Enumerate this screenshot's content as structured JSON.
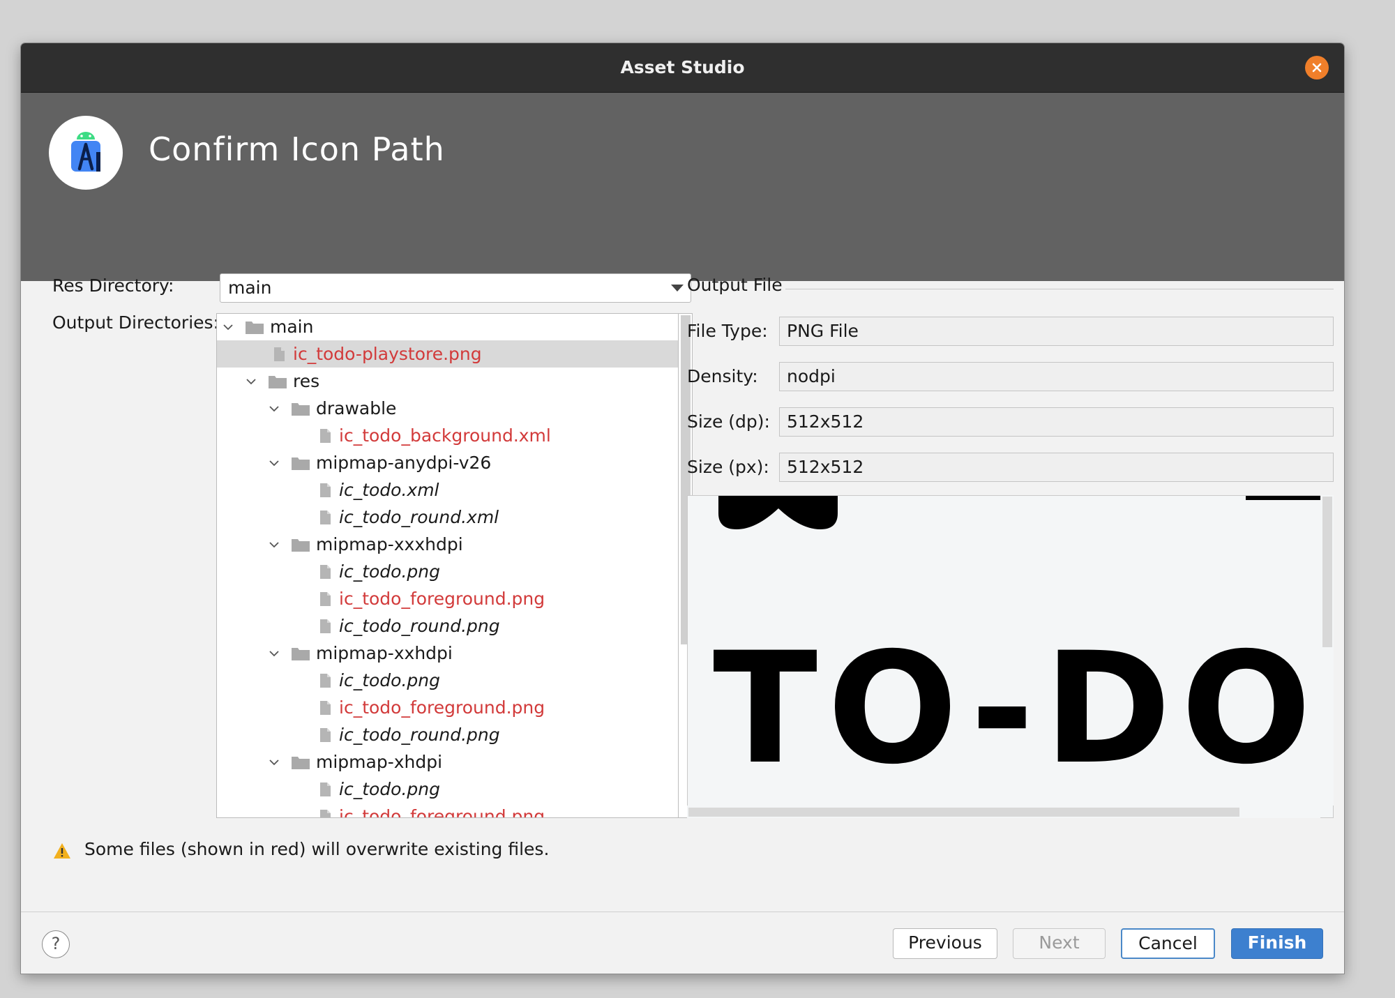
{
  "window": {
    "title": "Asset Studio",
    "header_title": "Confirm Icon Path"
  },
  "left": {
    "res_directory_label": "Res Directory:",
    "res_directory_value": "main",
    "output_directories_label": "Output Directories:"
  },
  "tree": [
    {
      "label": "main",
      "type": "folder",
      "depth": 0,
      "expanded": true,
      "red": false,
      "italic": false
    },
    {
      "label": "ic_todo-playstore.png",
      "type": "file",
      "depth": 1,
      "red": true,
      "italic": false,
      "selected": true
    },
    {
      "label": "res",
      "type": "folder",
      "depth": 1,
      "expanded": true,
      "red": false,
      "italic": false
    },
    {
      "label": "drawable",
      "type": "folder",
      "depth": 2,
      "expanded": true,
      "red": false,
      "italic": false
    },
    {
      "label": "ic_todo_background.xml",
      "type": "file",
      "depth": 3,
      "red": true,
      "italic": false
    },
    {
      "label": "mipmap-anydpi-v26",
      "type": "folder",
      "depth": 2,
      "expanded": true,
      "red": false,
      "italic": false
    },
    {
      "label": "ic_todo.xml",
      "type": "file",
      "depth": 3,
      "red": false,
      "italic": true
    },
    {
      "label": "ic_todo_round.xml",
      "type": "file",
      "depth": 3,
      "red": false,
      "italic": true
    },
    {
      "label": "mipmap-xxxhdpi",
      "type": "folder",
      "depth": 2,
      "expanded": true,
      "red": false,
      "italic": false
    },
    {
      "label": "ic_todo.png",
      "type": "file",
      "depth": 3,
      "red": false,
      "italic": true
    },
    {
      "label": "ic_todo_foreground.png",
      "type": "file",
      "depth": 3,
      "red": true,
      "italic": false
    },
    {
      "label": "ic_todo_round.png",
      "type": "file",
      "depth": 3,
      "red": false,
      "italic": true
    },
    {
      "label": "mipmap-xxhdpi",
      "type": "folder",
      "depth": 2,
      "expanded": true,
      "red": false,
      "italic": false
    },
    {
      "label": "ic_todo.png",
      "type": "file",
      "depth": 3,
      "red": false,
      "italic": true
    },
    {
      "label": "ic_todo_foreground.png",
      "type": "file",
      "depth": 3,
      "red": true,
      "italic": false
    },
    {
      "label": "ic_todo_round.png",
      "type": "file",
      "depth": 3,
      "red": false,
      "italic": true
    },
    {
      "label": "mipmap-xhdpi",
      "type": "folder",
      "depth": 2,
      "expanded": true,
      "red": false,
      "italic": false
    },
    {
      "label": "ic_todo.png",
      "type": "file",
      "depth": 3,
      "red": false,
      "italic": true
    },
    {
      "label": "ic_todo_foreground.png",
      "type": "file",
      "depth": 3,
      "red": true,
      "italic": false
    }
  ],
  "output_file": {
    "section_label": "Output File",
    "file_type_label": "File Type:",
    "file_type_value": "PNG File",
    "density_label": "Density:",
    "density_value": "nodpi",
    "size_dp_label": "Size (dp):",
    "size_dp_value": "512x512",
    "size_px_label": "Size (px):",
    "size_px_value": "512x512",
    "preview_text": "TO-DO"
  },
  "warning": {
    "text": "Some files (shown in red) will overwrite existing files."
  },
  "footer": {
    "help_label": "?",
    "previous_label": "Previous",
    "next_label": "Next",
    "cancel_label": "Cancel",
    "finish_label": "Finish"
  },
  "colors": {
    "overwrite_red": "#d23a3a",
    "finish_blue": "#3d80cf",
    "close_orange": "#f07f2a",
    "warning_yellow": "#f2b01e"
  }
}
